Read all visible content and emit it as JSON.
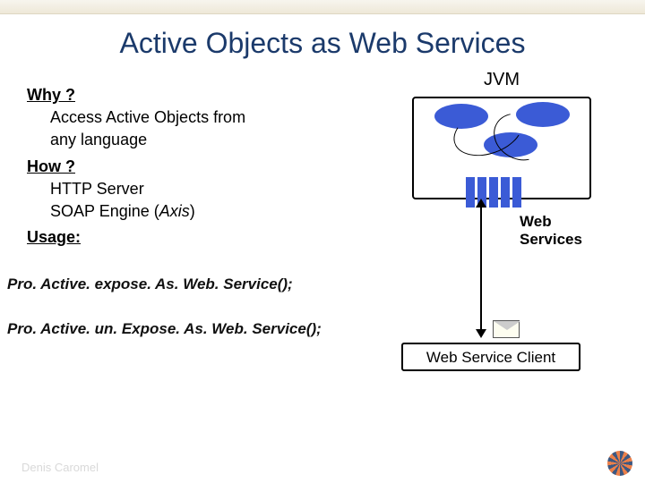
{
  "title": "Active Objects as Web Services",
  "left": {
    "why_h": "Why ?",
    "why_body1": "Access Active Objects from",
    "why_body2": "any language",
    "how_h": "How ?",
    "how_body1": "HTTP Server",
    "how_body2_a": "SOAP Engine (",
    "how_body2_b": "Axis",
    "how_body2_c": ")",
    "usage_h": "Usage:"
  },
  "code": {
    "line1": "Pro. Active. expose. As. Web. Service();",
    "line2": "Pro. Active. un. Expose. As. Web. Service();"
  },
  "diagram": {
    "jvm": "JVM",
    "web_services": "Web Services",
    "client": "Web Service Client"
  },
  "footer": "Denis Caromel"
}
